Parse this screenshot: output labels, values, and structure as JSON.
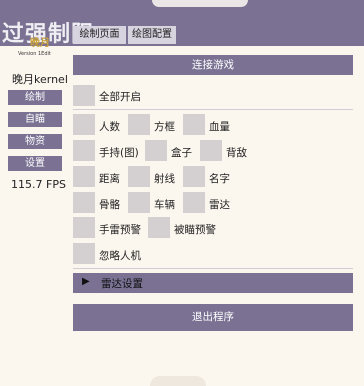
{
  "watermark": "过强制阳",
  "logo": {
    "main": "晚月",
    "sub": "Version 1Edit"
  },
  "sidebar": {
    "title": "晚月kernel",
    "items": [
      "绘制",
      "自瞄",
      "物资",
      "设置"
    ],
    "fps": "115.7 FPS"
  },
  "tabs": [
    "绘制页面",
    "绘图配置"
  ],
  "connect_button": "连接游戏",
  "all_on_label": "全部开启",
  "options": {
    "person_count": "人数",
    "box": "方框",
    "health": "血量",
    "held_item": "手持(图)",
    "crate": "盒子",
    "back": "背敌",
    "distance": "距离",
    "ray": "射线",
    "name": "名字",
    "skeleton": "骨骼",
    "vehicle": "车辆",
    "radar": "雷达",
    "grenade_warning": "手雷预警",
    "aimed_warning": "被瞄预警",
    "ignore_bots": "忽略人机"
  },
  "radar_settings": {
    "label": "雷达设置",
    "arrow": "▶"
  },
  "exit_button": "退出程序",
  "colors": {
    "accent": "#7a7193",
    "background": "#fbf6ee",
    "checkbox": "#d4d0d1"
  }
}
